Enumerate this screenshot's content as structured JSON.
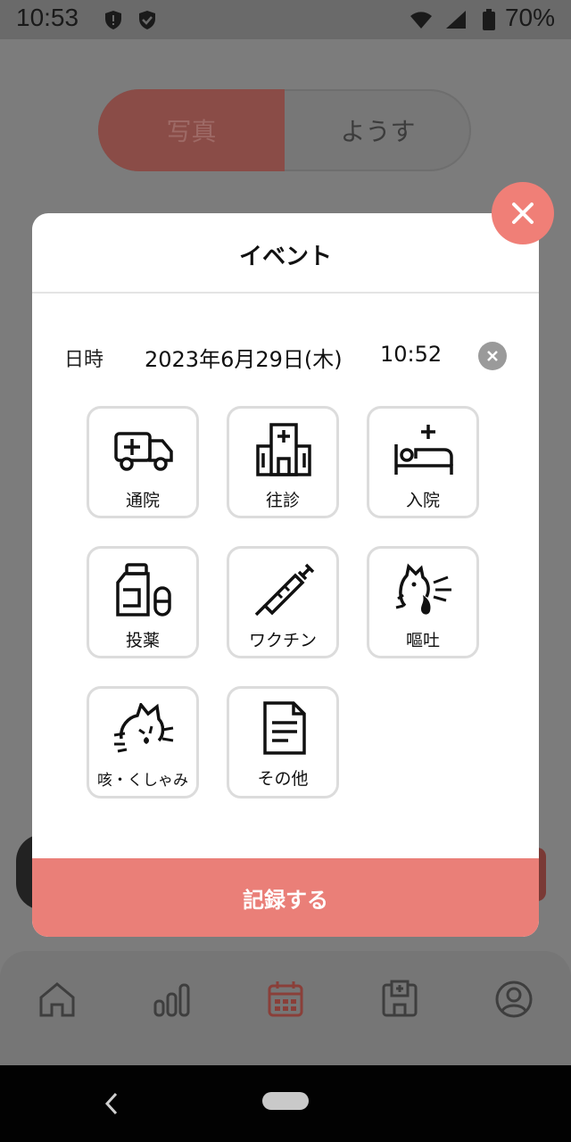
{
  "status_bar": {
    "time": "10:53",
    "battery": "70%"
  },
  "background": {
    "segment": {
      "left_label": "写真",
      "right_label": "ようす"
    },
    "bottom_nav": [
      "home-icon",
      "chart-icon",
      "calendar-icon",
      "hospital-card-icon",
      "profile-icon"
    ]
  },
  "modal": {
    "title": "イベント",
    "datetime": {
      "label": "日時",
      "date": "2023年6月29日(木)",
      "time": "10:52"
    },
    "items": [
      {
        "label": "通院",
        "icon": "ambulance-icon"
      },
      {
        "label": "往診",
        "icon": "hospital-icon"
      },
      {
        "label": "入院",
        "icon": "hospital-bed-icon"
      },
      {
        "label": "投薬",
        "icon": "medicine-icon"
      },
      {
        "label": "ワクチン",
        "icon": "syringe-icon"
      },
      {
        "label": "嘔吐",
        "icon": "vomit-icon"
      },
      {
        "label": "咳・くしゃみ",
        "icon": "cat-sneeze-icon"
      },
      {
        "label": "その他",
        "icon": "document-icon"
      }
    ],
    "record_button": "記録する"
  },
  "colors": {
    "accent": "#ea7f78",
    "close": "#f07f77"
  }
}
